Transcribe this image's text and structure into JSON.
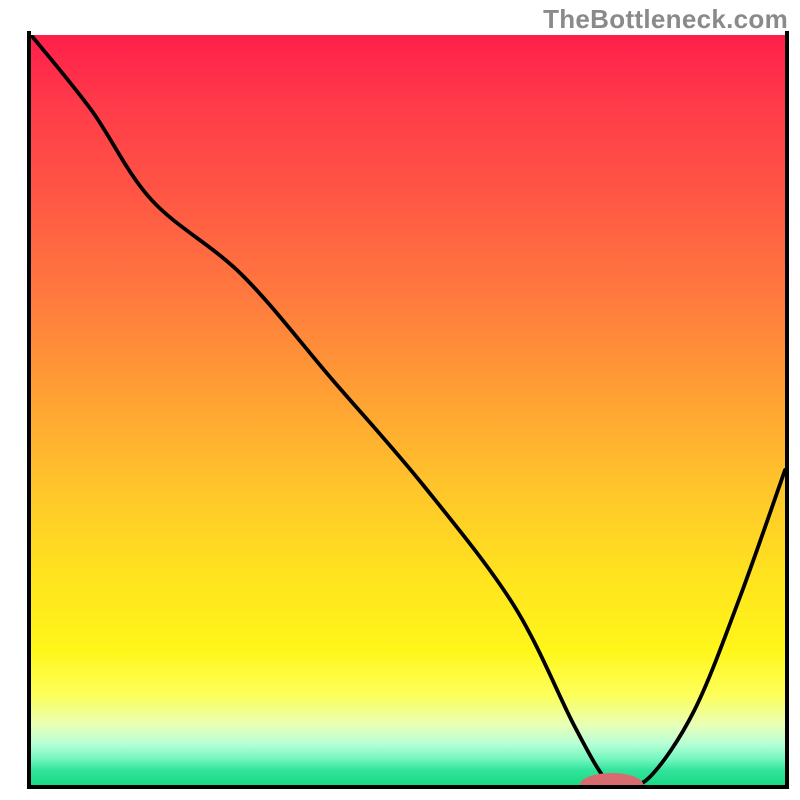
{
  "watermark": "TheBottleneck.com",
  "chart_data": {
    "type": "line",
    "title": "",
    "xlabel": "",
    "ylabel": "",
    "xlim": [
      0,
      100
    ],
    "ylim": [
      0,
      100
    ],
    "series": [
      {
        "name": "bottleneck-curve",
        "x": [
          0,
          8,
          16,
          28,
          40,
          52,
          64,
          72,
          76,
          78,
          82,
          88,
          94,
          100
        ],
        "values": [
          100,
          90,
          78,
          68,
          54,
          40,
          24,
          8,
          1,
          0,
          1,
          10,
          25,
          42
        ]
      }
    ],
    "highlight": {
      "name": "optimal-marker",
      "x": 77,
      "y": 0,
      "rx": 4.2,
      "ry": 1.6,
      "color": "#d86b6f"
    },
    "background_gradient": {
      "stops": [
        {
          "pos": 0,
          "color": "#ff1f4a"
        },
        {
          "pos": 9,
          "color": "#ff3a4a"
        },
        {
          "pos": 22,
          "color": "#ff5844"
        },
        {
          "pos": 35,
          "color": "#ff7a3e"
        },
        {
          "pos": 48,
          "color": "#ffa034"
        },
        {
          "pos": 60,
          "color": "#ffc42b"
        },
        {
          "pos": 72,
          "color": "#ffe31f"
        },
        {
          "pos": 82,
          "color": "#fff61a"
        },
        {
          "pos": 88,
          "color": "#fdff5a"
        },
        {
          "pos": 92,
          "color": "#e8ffb7"
        },
        {
          "pos": 94.5,
          "color": "#b7ffd6"
        },
        {
          "pos": 96.5,
          "color": "#74f7c0"
        },
        {
          "pos": 98,
          "color": "#33e49b"
        },
        {
          "pos": 100,
          "color": "#19d985"
        }
      ]
    }
  }
}
